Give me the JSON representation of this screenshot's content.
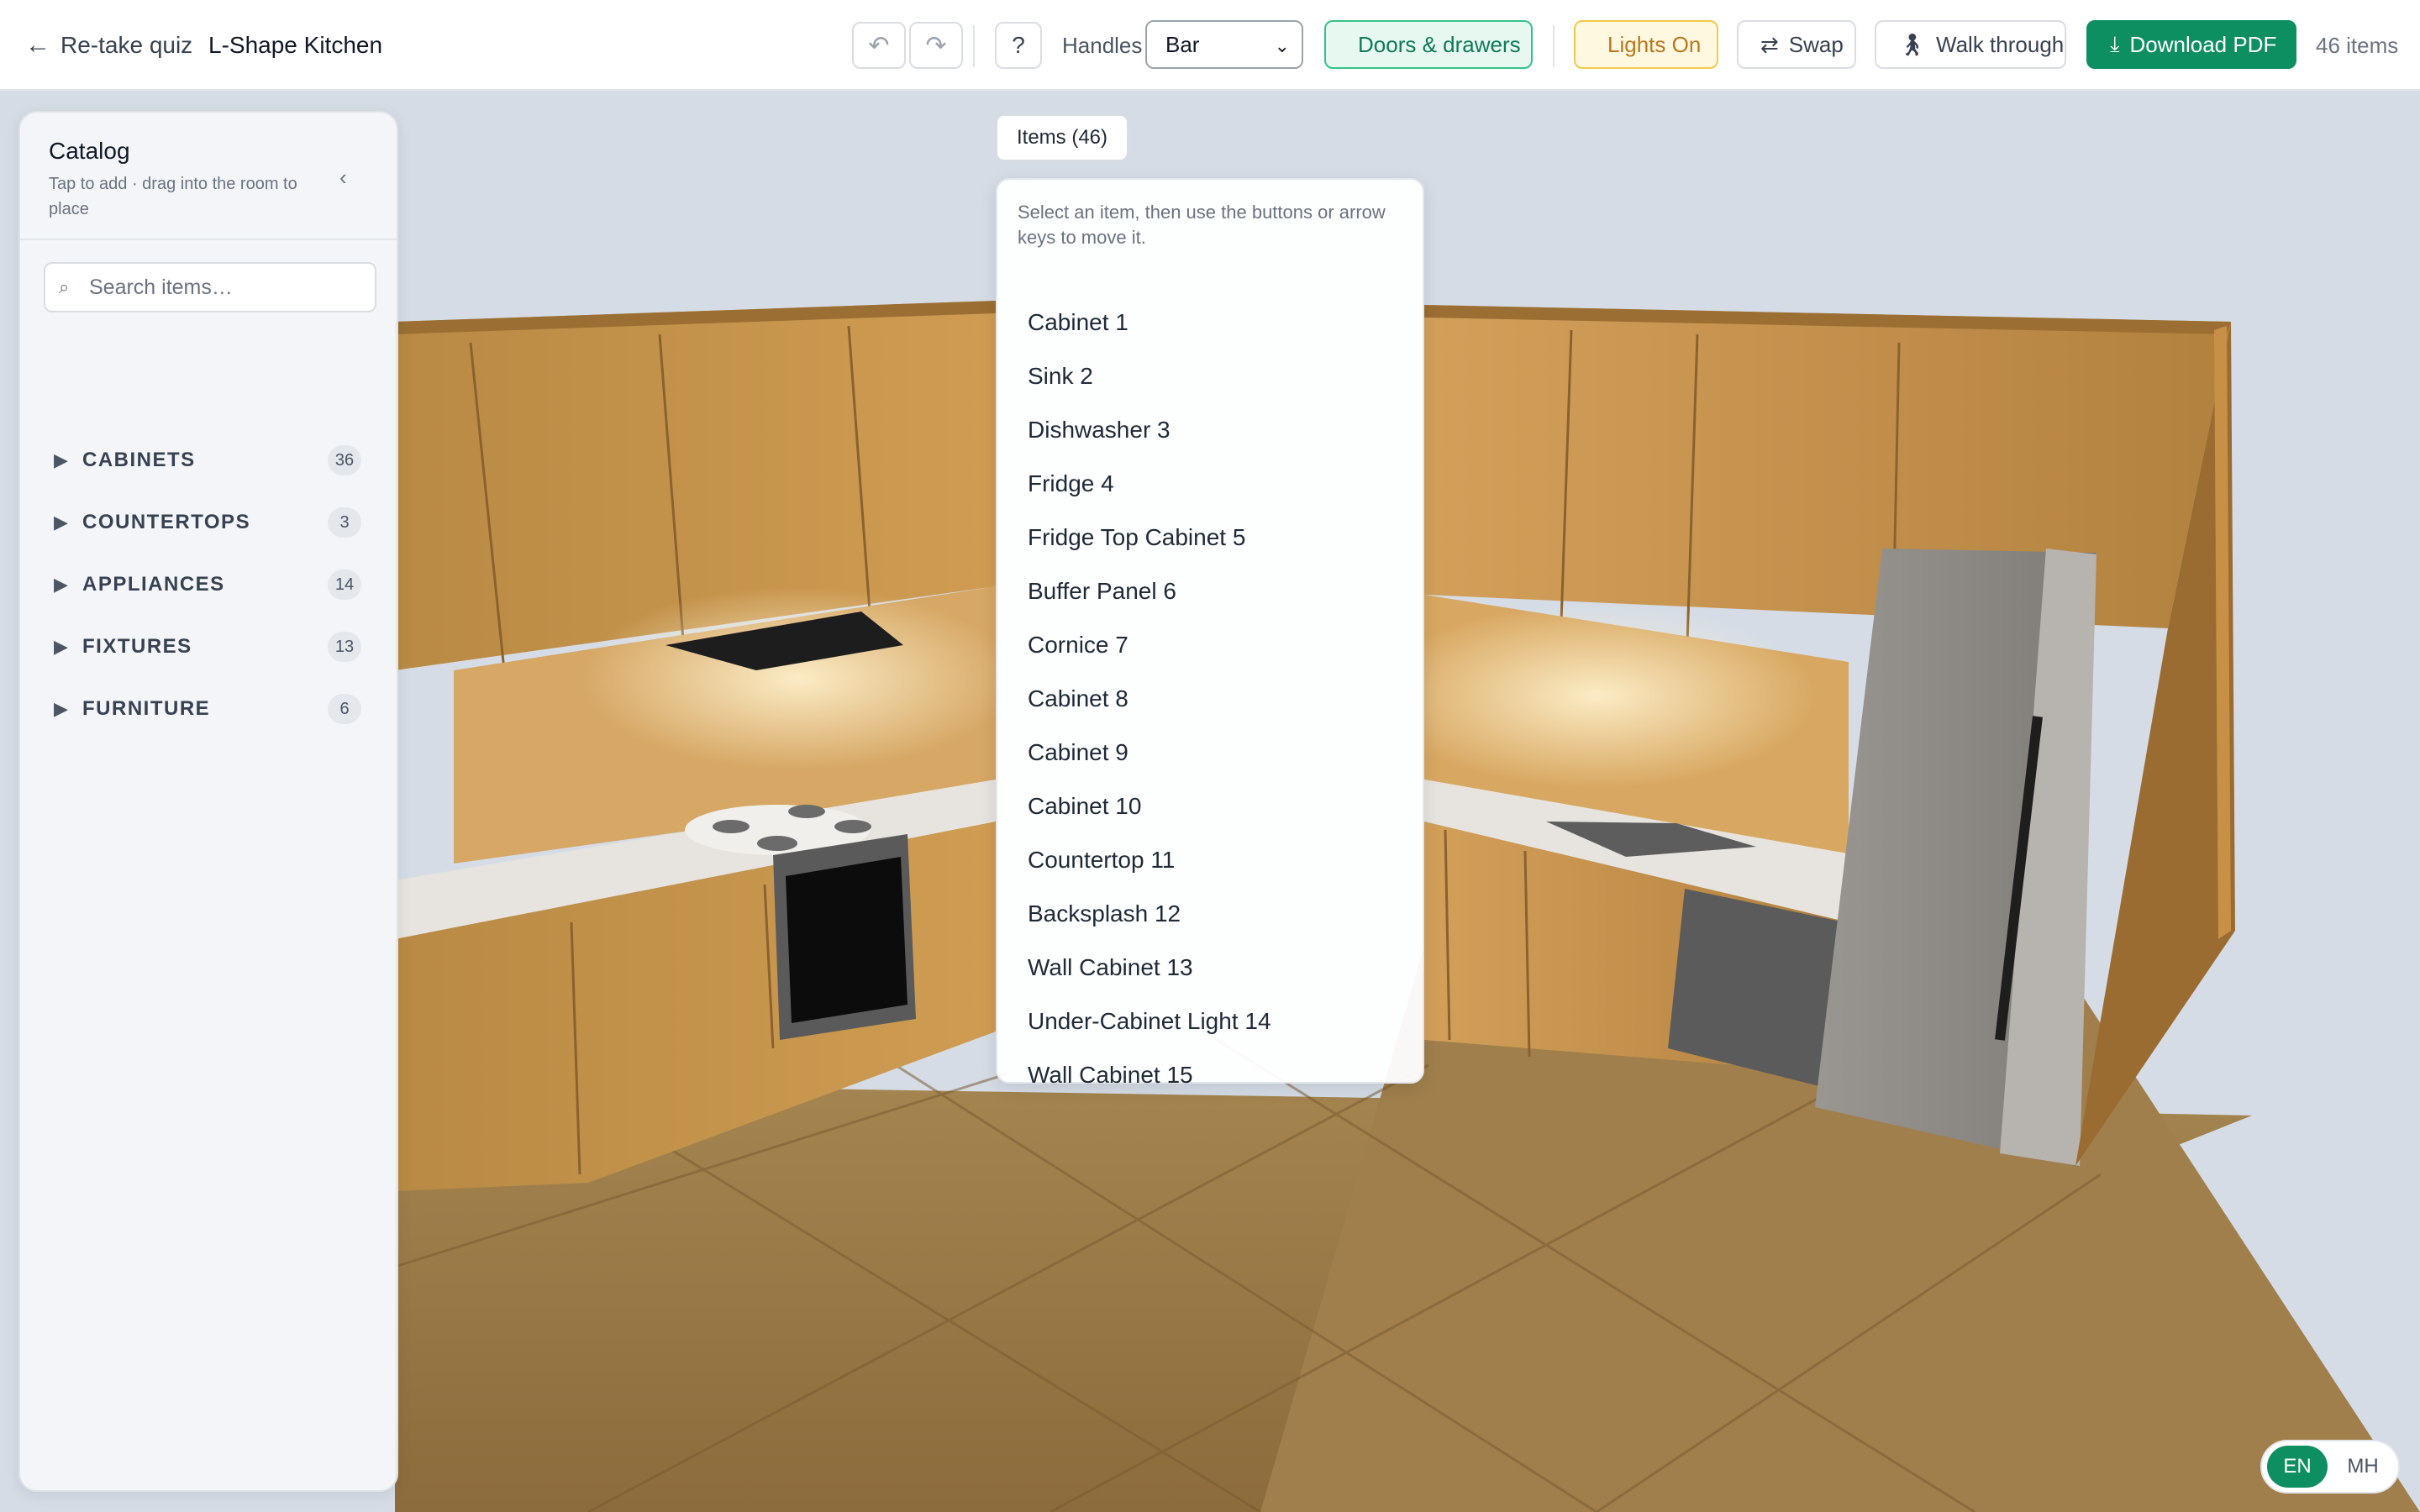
{
  "topbar": {
    "back_label": "Re-take quiz",
    "back_icon": "arrow-left-icon",
    "title": "L-Shape Kitchen",
    "undo_icon": "undo-icon",
    "redo_icon": "redo-icon",
    "help_label": "?",
    "handles_label": "Handles",
    "handles_value": "Bar",
    "doors_label": "Doors & drawers",
    "lights_label": "Lights On",
    "swap_label": "Swap",
    "walk_label": "Walk through",
    "pdf_label": "Download PDF",
    "items_count": "46 items"
  },
  "catalog": {
    "title": "Catalog",
    "subtitle": "Tap to add · drag into the room to place",
    "collapse_icon": "‹",
    "search_placeholder": "Search items…",
    "categories": [
      {
        "name": "CABINETS",
        "count": "36"
      },
      {
        "name": "COUNTERTOPS",
        "count": "3"
      },
      {
        "name": "APPLIANCES",
        "count": "14"
      },
      {
        "name": "FIXTURES",
        "count": "13"
      },
      {
        "name": "FURNITURE",
        "count": "6"
      }
    ]
  },
  "items_panel": {
    "tab_label": "Items (46)",
    "hint": "Select an item, then use the buttons or arrow keys to move it.",
    "items": [
      "Cabinet 1",
      "Sink 2",
      "Dishwasher 3",
      "Fridge 4",
      "Fridge Top Cabinet 5",
      "Buffer Panel 6",
      "Cornice 7",
      "Cabinet 8",
      "Cabinet 9",
      "Cabinet 10",
      "Countertop 11",
      "Backsplash 12",
      "Wall Cabinet 13",
      "Under-Cabinet Light 14",
      "Wall Cabinet 15"
    ]
  },
  "language": {
    "active": "EN",
    "other": "MH"
  },
  "colors": {
    "accent_green": "#0e8f61",
    "doors_green": "#34c28a",
    "lights_amber": "#f2c94c",
    "wood": "#c8913f",
    "floor": "#b08a55"
  }
}
